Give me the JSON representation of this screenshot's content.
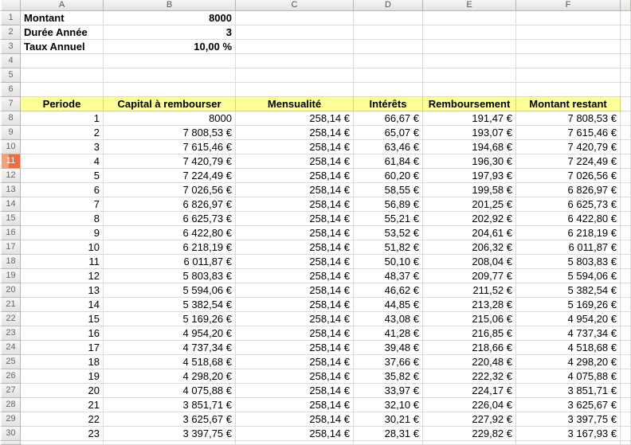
{
  "colors": {
    "header_bg_top": "#f7f6f4",
    "header_bg_bottom": "#e3e2e0",
    "header_border": "#b9b7b4",
    "grid_line": "#dadada",
    "yellow_header_bg": "#ffff99",
    "selected_row_header_bg": "#ea6e41",
    "selected_row_header_bg_light": "#f4a17b",
    "selected_row_header_text": "#ffffff",
    "spellcheck_underline": "#e8402a",
    "cell_text": "#000000"
  },
  "spreadsheet": {
    "column_letters": [
      "A",
      "B",
      "C",
      "D",
      "E",
      "F"
    ],
    "visible_row_count": 30,
    "selected_row": 11,
    "params": [
      {
        "label": "Montant",
        "value": "8000"
      },
      {
        "label": "Durée Année",
        "value": "3"
      },
      {
        "label": "Taux Annuel",
        "value": "10,00 %"
      }
    ],
    "table": {
      "header_row": 7,
      "data_start_row": 8,
      "headers": [
        "Periode",
        "Capital à rembourser",
        "Mensualité",
        "Intérêts",
        "Remboursement",
        "Montant restant"
      ],
      "rows": [
        [
          "1",
          "8000",
          "258,14 €",
          "66,67 €",
          "191,47 €",
          "7 808,53 €"
        ],
        [
          "2",
          "7 808,53 €",
          "258,14 €",
          "65,07 €",
          "193,07 €",
          "7 615,46 €"
        ],
        [
          "3",
          "7 615,46 €",
          "258,14 €",
          "63,46 €",
          "194,68 €",
          "7 420,79 €"
        ],
        [
          "4",
          "7 420,79 €",
          "258,14 €",
          "61,84 €",
          "196,30 €",
          "7 224,49 €"
        ],
        [
          "5",
          "7 224,49 €",
          "258,14 €",
          "60,20 €",
          "197,93 €",
          "7 026,56 €"
        ],
        [
          "6",
          "7 026,56 €",
          "258,14 €",
          "58,55 €",
          "199,58 €",
          "6 826,97 €"
        ],
        [
          "7",
          "6 826,97 €",
          "258,14 €",
          "56,89 €",
          "201,25 €",
          "6 625,73 €"
        ],
        [
          "8",
          "6 625,73 €",
          "258,14 €",
          "55,21 €",
          "202,92 €",
          "6 422,80 €"
        ],
        [
          "9",
          "6 422,80 €",
          "258,14 €",
          "53,52 €",
          "204,61 €",
          "6 218,19 €"
        ],
        [
          "10",
          "6 218,19 €",
          "258,14 €",
          "51,82 €",
          "206,32 €",
          "6 011,87 €"
        ],
        [
          "11",
          "6 011,87 €",
          "258,14 €",
          "50,10 €",
          "208,04 €",
          "5 803,83 €"
        ],
        [
          "12",
          "5 803,83 €",
          "258,14 €",
          "48,37 €",
          "209,77 €",
          "5 594,06 €"
        ],
        [
          "13",
          "5 594,06 €",
          "258,14 €",
          "46,62 €",
          "211,52 €",
          "5 382,54 €"
        ],
        [
          "14",
          "5 382,54 €",
          "258,14 €",
          "44,85 €",
          "213,28 €",
          "5 169,26 €"
        ],
        [
          "15",
          "5 169,26 €",
          "258,14 €",
          "43,08 €",
          "215,06 €",
          "4 954,20 €"
        ],
        [
          "16",
          "4 954,20 €",
          "258,14 €",
          "41,28 €",
          "216,85 €",
          "4 737,34 €"
        ],
        [
          "17",
          "4 737,34 €",
          "258,14 €",
          "39,48 €",
          "218,66 €",
          "4 518,68 €"
        ],
        [
          "18",
          "4 518,68 €",
          "258,14 €",
          "37,66 €",
          "220,48 €",
          "4 298,20 €"
        ],
        [
          "19",
          "4 298,20 €",
          "258,14 €",
          "35,82 €",
          "222,32 €",
          "4 075,88 €"
        ],
        [
          "20",
          "4 075,88 €",
          "258,14 €",
          "33,97 €",
          "224,17 €",
          "3 851,71 €"
        ],
        [
          "21",
          "3 851,71 €",
          "258,14 €",
          "32,10 €",
          "226,04 €",
          "3 625,67 €"
        ],
        [
          "22",
          "3 625,67 €",
          "258,14 €",
          "30,21 €",
          "227,92 €",
          "3 397,75 €"
        ],
        [
          "23",
          "3 397,75 €",
          "258,14 €",
          "28,31 €",
          "229,82 €",
          "3 167,93 €"
        ]
      ]
    }
  }
}
